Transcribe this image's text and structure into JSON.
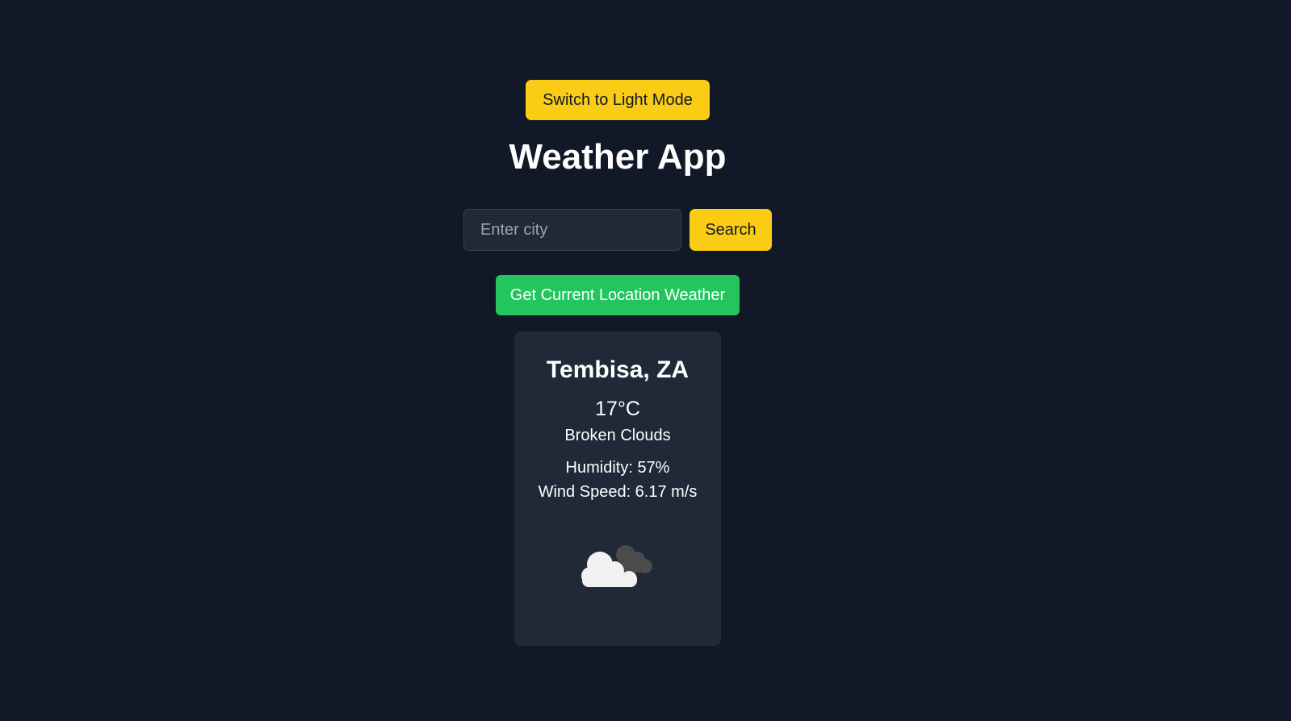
{
  "header": {
    "theme_toggle_label": "Switch to Light Mode",
    "title": "Weather App"
  },
  "search": {
    "placeholder": "Enter city",
    "value": "",
    "button_label": "Search"
  },
  "location": {
    "button_label": "Get Current Location Weather"
  },
  "weather": {
    "city": "Tembisa, ZA",
    "temperature": "17°C",
    "description": "Broken Clouds",
    "humidity": "Humidity: 57%",
    "wind": "Wind Speed: 6.17 m/s",
    "icon": "broken-clouds-icon"
  },
  "colors": {
    "background": "#111827",
    "card": "#1f2937",
    "accent_yellow": "#facc15",
    "accent_green": "#22c55e",
    "text": "#ffffff"
  }
}
